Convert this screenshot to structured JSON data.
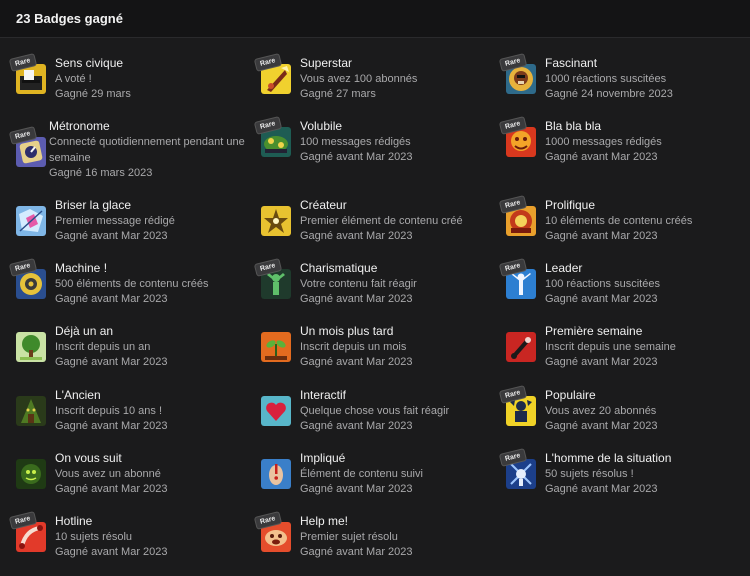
{
  "header": {
    "title": "23 Badges gagné"
  },
  "rare_label": "Rare",
  "badges": [
    {
      "name": "Sens civique",
      "desc": "A voté !",
      "date": "Gagné 29 mars",
      "rare": true,
      "icon": "vote-icon"
    },
    {
      "name": "Superstar",
      "desc": "Vous avez 100 abonnés",
      "date": "Gagné 27 mars",
      "rare": true,
      "icon": "superstar-icon"
    },
    {
      "name": "Fascinant",
      "desc": "1000 réactions suscitées",
      "date": "Gagné 24 novembre 2023",
      "rare": true,
      "icon": "fascinating-icon"
    },
    {
      "name": "Métronome",
      "desc": "Connecté quotidiennement pendant une semaine",
      "date": "Gagné 16 mars 2023",
      "rare": true,
      "icon": "metronome-icon"
    },
    {
      "name": "Volubile",
      "desc": "100 messages rédigés",
      "date": "Gagné avant Mar 2023",
      "rare": true,
      "icon": "voluble-icon"
    },
    {
      "name": "Bla bla bla",
      "desc": "1000 messages rédigés",
      "date": "Gagné avant Mar 2023",
      "rare": true,
      "icon": "blablabla-icon"
    },
    {
      "name": "Briser la glace",
      "desc": "Premier message rédigé",
      "date": "Gagné avant Mar 2023",
      "rare": false,
      "icon": "ice-breaker-icon"
    },
    {
      "name": "Créateur",
      "desc": "Premier élément de contenu créé",
      "date": "Gagné avant Mar 2023",
      "rare": false,
      "icon": "creator-icon"
    },
    {
      "name": "Prolifique",
      "desc": "10 éléments de contenu créés",
      "date": "Gagné avant Mar 2023",
      "rare": true,
      "icon": "prolific-icon"
    },
    {
      "name": "Machine !",
      "desc": "500 éléments de contenu créés",
      "date": "Gagné avant Mar 2023",
      "rare": true,
      "icon": "machine-icon"
    },
    {
      "name": "Charismatique",
      "desc": "Votre contenu fait réagir",
      "date": "Gagné avant Mar 2023",
      "rare": true,
      "icon": "charismatic-icon"
    },
    {
      "name": "Leader",
      "desc": "100 réactions suscitées",
      "date": "Gagné avant Mar 2023",
      "rare": true,
      "icon": "leader-icon"
    },
    {
      "name": "Déjà un an",
      "desc": "Inscrit depuis un an",
      "date": "Gagné avant Mar 2023",
      "rare": false,
      "icon": "tree-icon"
    },
    {
      "name": "Un mois plus tard",
      "desc": "Inscrit depuis un mois",
      "date": "Gagné avant Mar 2023",
      "rare": false,
      "icon": "sprout-icon"
    },
    {
      "name": "Première semaine",
      "desc": "Inscrit depuis une semaine",
      "date": "Gagné avant Mar 2023",
      "rare": false,
      "icon": "first-week-icon"
    },
    {
      "name": "L'Ancien",
      "desc": "Inscrit depuis 10 ans !",
      "date": "Gagné avant Mar 2023",
      "rare": false,
      "icon": "ancient-icon"
    },
    {
      "name": "Interactif",
      "desc": "Quelque chose vous fait réagir",
      "date": "Gagné avant Mar 2023",
      "rare": false,
      "icon": "heart-icon"
    },
    {
      "name": "Populaire",
      "desc": "Vous avez 20 abonnés",
      "date": "Gagné avant Mar 2023",
      "rare": true,
      "icon": "popular-icon"
    },
    {
      "name": "On vous suit",
      "desc": "Vous avez un abonné",
      "date": "Gagné avant Mar 2023",
      "rare": false,
      "icon": "followed-icon"
    },
    {
      "name": "Impliqué",
      "desc": "Élément de contenu suivi",
      "date": "Gagné avant Mar 2023",
      "rare": false,
      "icon": "involved-icon"
    },
    {
      "name": "L'homme de la situation",
      "desc": "50 sujets résolus !",
      "date": "Gagné avant Mar 2023",
      "rare": true,
      "icon": "man-of-situation-icon"
    },
    {
      "name": "Hotline",
      "desc": "10 sujets résolu",
      "date": "Gagné avant Mar 2023",
      "rare": true,
      "icon": "hotline-icon"
    },
    {
      "name": "Help me!",
      "desc": "Premier sujet résolu",
      "date": "Gagné avant Mar 2023",
      "rare": true,
      "icon": "help-me-icon"
    }
  ]
}
